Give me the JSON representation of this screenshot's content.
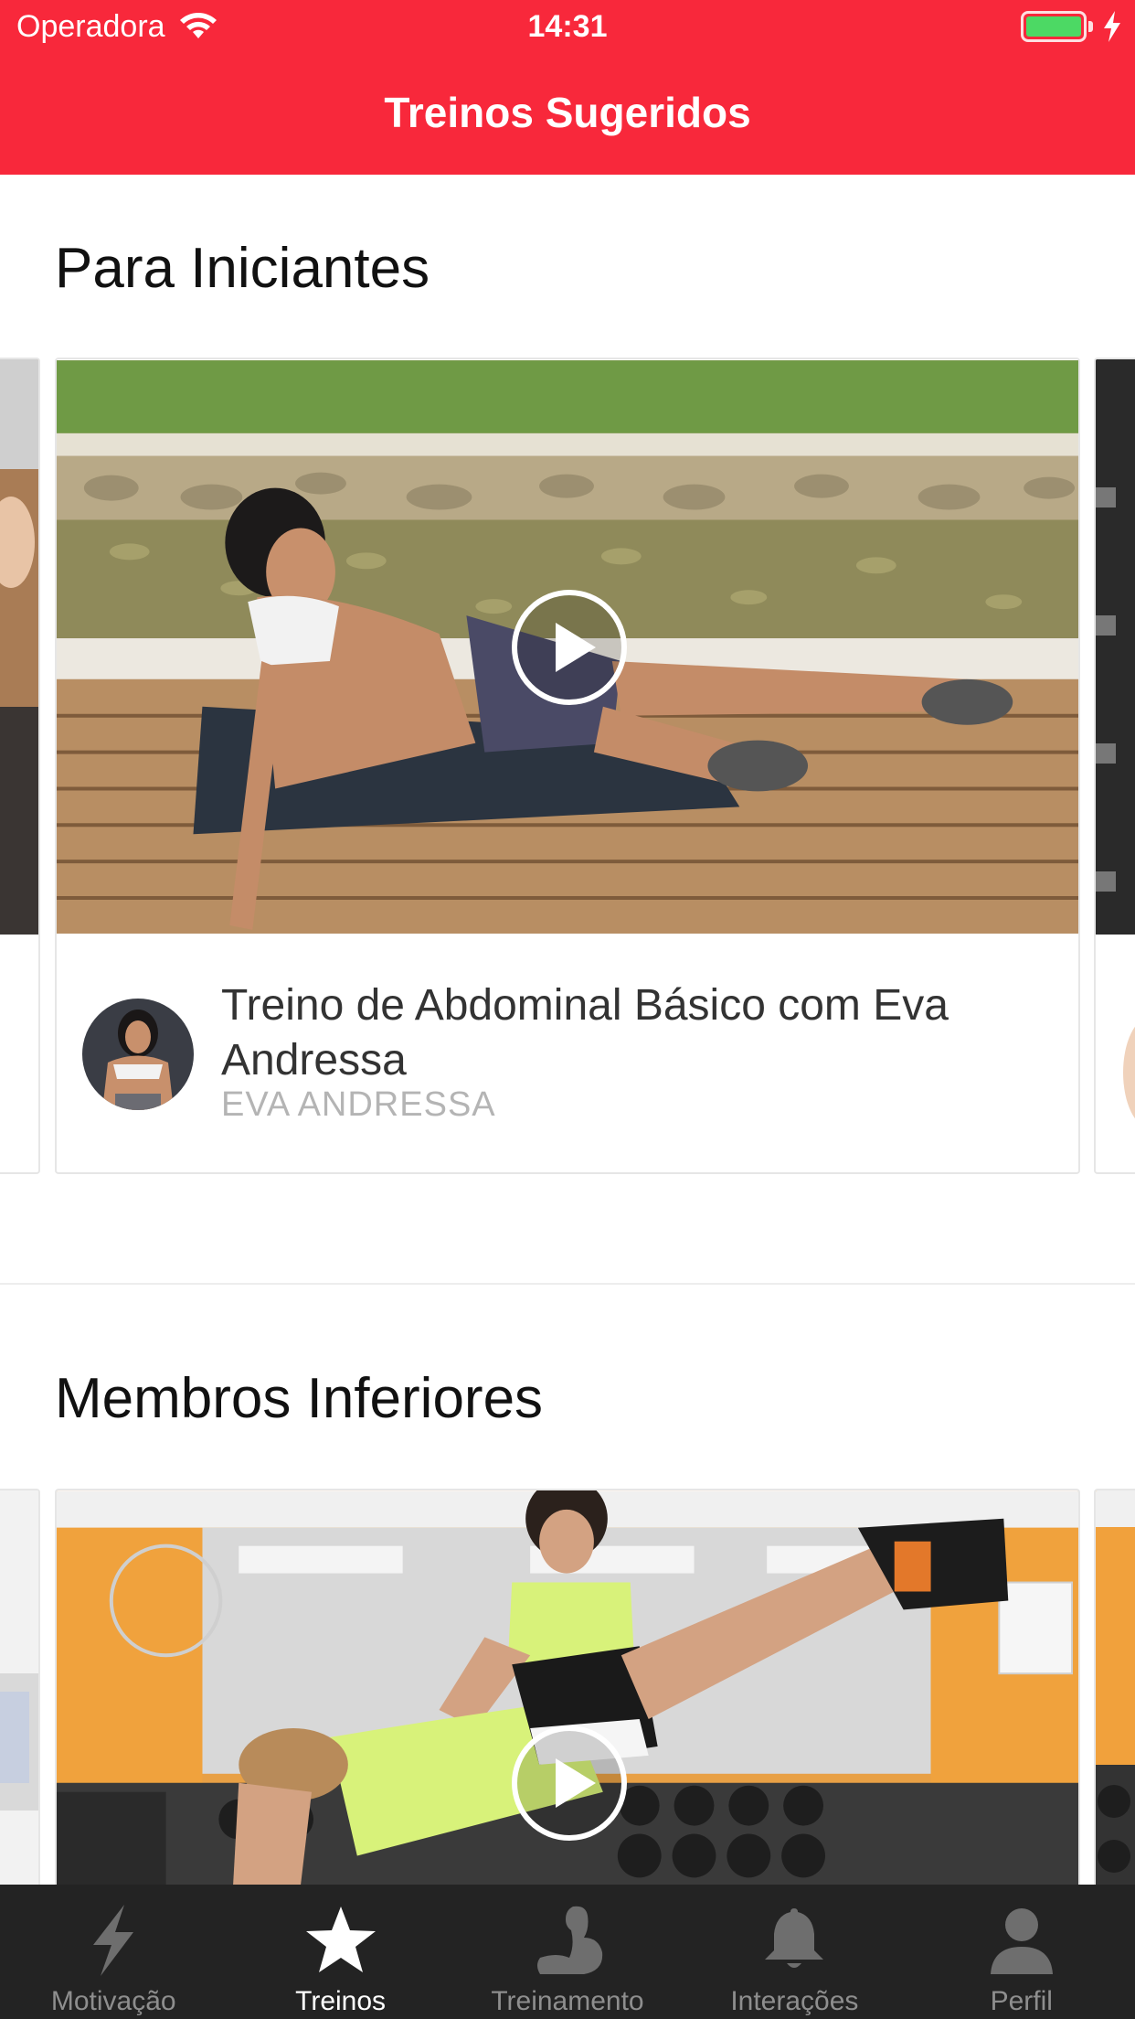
{
  "status_bar": {
    "carrier": "Operadora",
    "time": "14:31"
  },
  "header": {
    "title": "Treinos Sugeridos"
  },
  "sections": [
    {
      "title": "Para Iniciantes",
      "card": {
        "title": "Treino de Abdominal Básico com Eva Andressa",
        "author": "EVA ANDRESSA"
      }
    },
    {
      "title": "Membros Inferiores"
    }
  ],
  "tab_bar": {
    "active": "Treinos",
    "tabs": [
      {
        "label": "Motivação",
        "icon": "lightning-bolt-icon"
      },
      {
        "label": "Treinos",
        "icon": "star-icon"
      },
      {
        "label": "Treinamento",
        "icon": "flexed-arm-icon"
      },
      {
        "label": "Interações",
        "icon": "bell-icon"
      },
      {
        "label": "Perfil",
        "icon": "person-icon"
      }
    ]
  },
  "colors": {
    "accent": "#f8283b",
    "battery": "#4cd964",
    "tab_bar_bg": "#232323",
    "tab_inactive": "#8e8e8e",
    "tab_active": "#ffffff"
  }
}
